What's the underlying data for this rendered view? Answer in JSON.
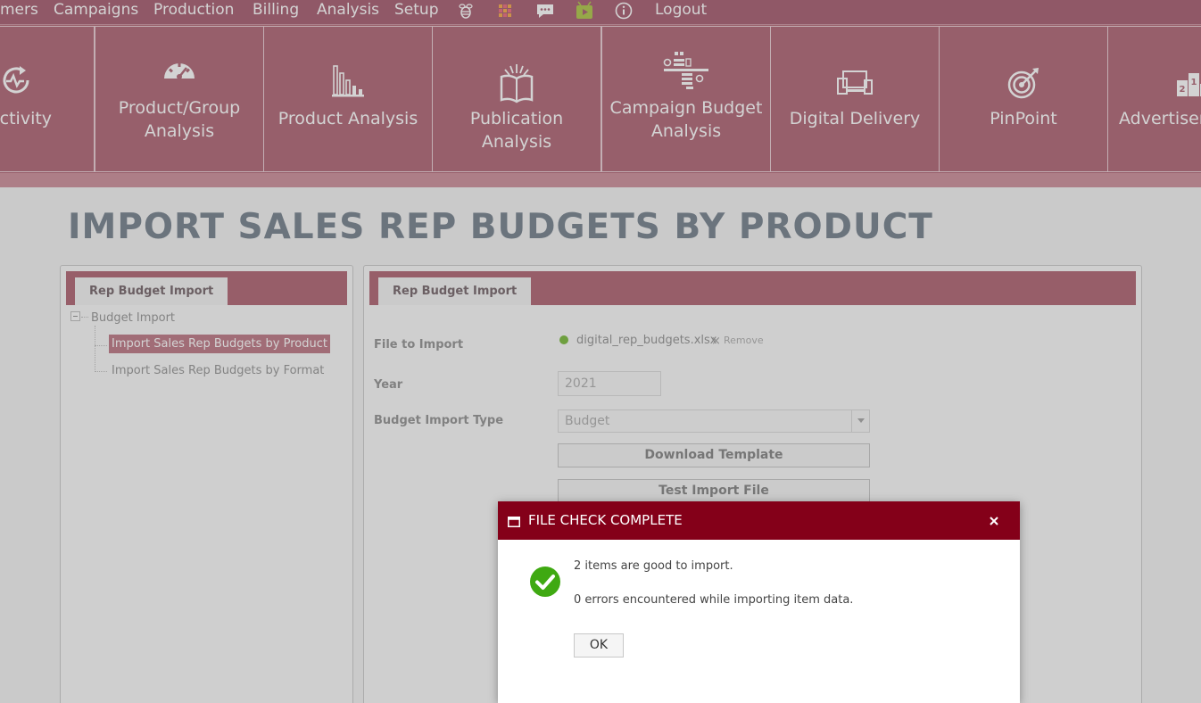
{
  "topnav": {
    "items": [
      "mers",
      "Campaigns",
      "Production",
      "Billing",
      "Analysis",
      "Setup"
    ],
    "icons": [
      "bee-icon",
      "apps-grid-icon",
      "chat-icon",
      "video-icon",
      "info-icon"
    ],
    "logout": "Logout"
  },
  "tiles": [
    {
      "label": "Activity",
      "icon": "activity-refresh-icon"
    },
    {
      "label": "Product/Group Analysis",
      "icon": "speedometer-icon"
    },
    {
      "label": "Product Analysis",
      "icon": "bar-chart-icon"
    },
    {
      "label": "Publication Analysis",
      "icon": "open-book-icon"
    },
    {
      "label": "Campaign Budget Analysis",
      "icon": "budget-sliders-icon"
    },
    {
      "label": "Digital Delivery",
      "icon": "devices-icon"
    },
    {
      "label": "PinPoint",
      "icon": "target-icon"
    },
    {
      "label": "Advertiser",
      "icon": "podium-icon"
    }
  ],
  "page": {
    "title": "IMPORT SALES REP BUDGETS BY PRODUCT"
  },
  "left_panel": {
    "tab": "Rep Budget Import",
    "tree_root": "Budget Import",
    "tree_items": [
      "Import Sales Rep Budgets by Product",
      "Import Sales Rep Budgets by Format"
    ]
  },
  "right_panel": {
    "tab": "Rep Budget Import",
    "file_label": "File to Import",
    "file_name": "digital_rep_budgets.xlsx",
    "remove_label": "Remove",
    "year_label": "Year",
    "year_value": "2021",
    "type_label": "Budget Import Type",
    "type_value": "Budget",
    "download_button": "Download Template",
    "test_button": "Test Import File"
  },
  "dialog": {
    "title": "FILE CHECK COMPLETE",
    "message1": "2 items are good to import.",
    "message2": "0 errors encountered while importing item data.",
    "ok": "OK"
  },
  "colors": {
    "nav": "#a05065",
    "tile": "#a9596a",
    "dialog_title": "#840019",
    "success": "#3fa912"
  }
}
